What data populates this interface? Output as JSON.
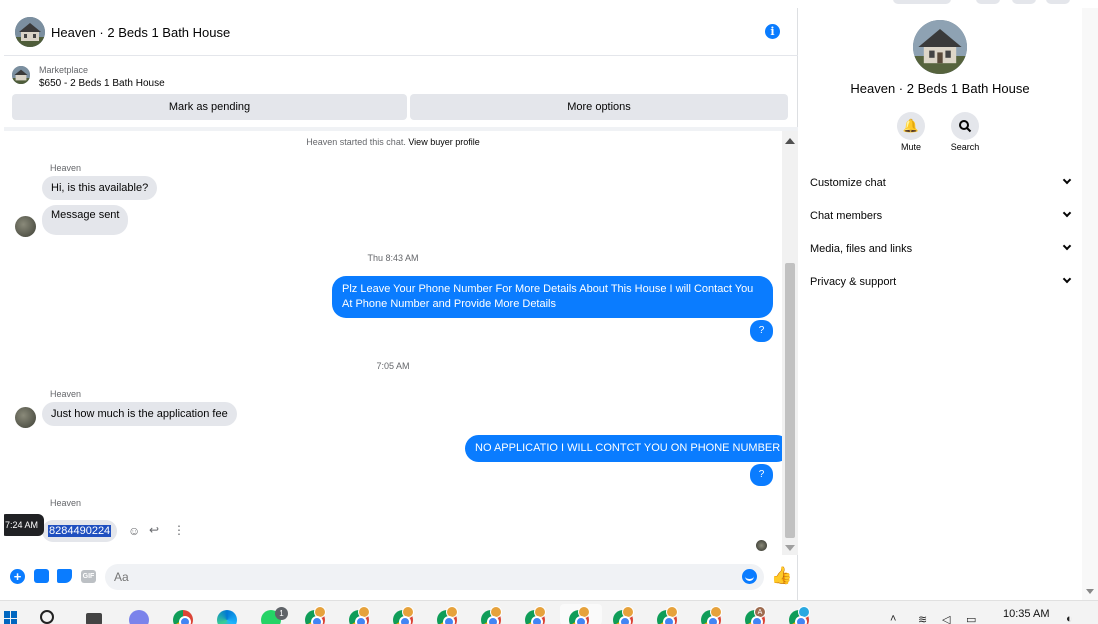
{
  "colors": {
    "accent": "#0a7cff",
    "incoming_bubble": "#e4e6eb",
    "background": "#ffffff"
  },
  "chat": {
    "title": "Heaven · 2 Beds 1 Bath House",
    "info_icon": "info-icon",
    "marketplace_label": "Marketplace",
    "marketplace_listing": "$650 - 2 Beds 1 Bath House",
    "mark_pending_label": "Mark as pending",
    "more_options_label": "More options",
    "started_text": "Heaven started this chat.",
    "view_profile_label": "View buyer profile",
    "messages": {
      "sender1": "Heaven",
      "in1": "Hi, is this available?",
      "in2": "Message sent",
      "time1": "Thu 8:43 AM",
      "out1": "Plz Leave Your Phone Number For More Details About This House I will Contact You At Phone Number and Provide More Details",
      "q1": "?",
      "time2": "7:05 AM",
      "sender2": "Heaven",
      "in3": "Just how much is the application fee",
      "out2": "NO APPLICATIO I WILL CONTCT YOU ON PHONE NUMBER",
      "q2": "?",
      "sender3": "Heaven",
      "in4": "8284490224",
      "hover_time": "7:24 AM"
    },
    "composer_placeholder": "Aa",
    "gif_label": "GIF"
  },
  "info_panel": {
    "name": "Heaven · 2 Beds 1 Bath House",
    "mute_label": "Mute",
    "search_label": "Search",
    "sections": [
      "Customize chat",
      "Chat members",
      "Media, files and links",
      "Privacy & support"
    ]
  },
  "taskbar": {
    "clock": "10:35 AM",
    "whatsapp_badge": "1",
    "profile_letter": "A"
  }
}
